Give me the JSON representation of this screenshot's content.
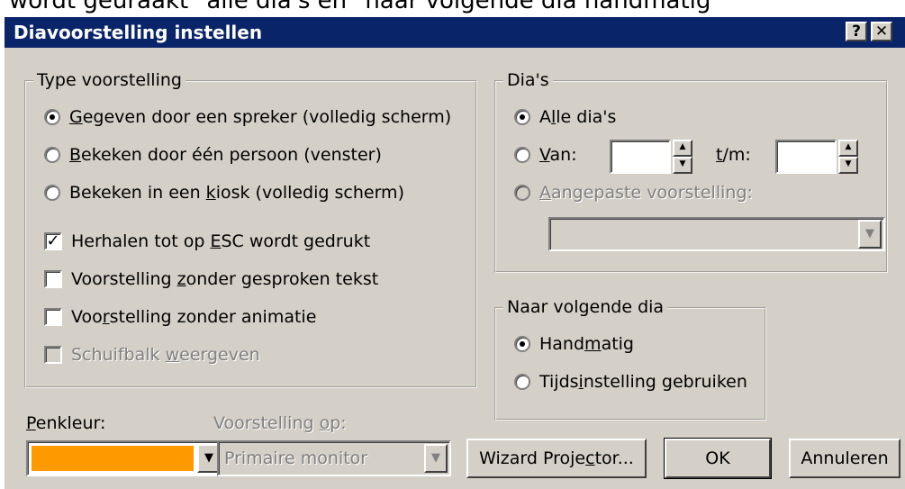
{
  "doc_text": "wordt geuraakt \"alle dia's en \"naar volgende dia handmatig",
  "dialog": {
    "title": "Diavoorstelling instellen",
    "help_label": "?",
    "close_label": "✕"
  },
  "type_group": {
    "legend": "Type voorstelling",
    "radios": [
      {
        "pre": "",
        "key": "G",
        "post": "egeven door een spreker (volledig scherm)",
        "checked": true
      },
      {
        "pre": "",
        "key": "B",
        "post": "ekeken door één persoon (venster)",
        "checked": false
      },
      {
        "pre": "Bekeken in een ",
        "key": "k",
        "post": "iosk (volledig scherm)",
        "checked": false
      }
    ],
    "checks": [
      {
        "pre": "Herhalen tot op ",
        "key": "E",
        "post": "SC wordt gedrukt",
        "checked": true,
        "disabled": false
      },
      {
        "pre": "Voorstelling ",
        "key": "z",
        "post": "onder gesproken tekst",
        "checked": false,
        "disabled": false
      },
      {
        "pre": "Voo",
        "key": "r",
        "post": "stelling zonder animatie",
        "checked": false,
        "disabled": false
      },
      {
        "pre": "Schuifbalk ",
        "key": "w",
        "post": "eergeven",
        "checked": false,
        "disabled": true
      }
    ],
    "check_mark": "✓"
  },
  "dias_group": {
    "legend": "Dia's",
    "all": {
      "pre": "A",
      "key": "l",
      "post": "le dia's",
      "checked": true
    },
    "van": {
      "pre": "",
      "key": "V",
      "post": "an:",
      "checked": false,
      "value": ""
    },
    "tm": {
      "pre": "",
      "key": "t",
      "post": "/m:",
      "value": ""
    },
    "custom": {
      "pre": "",
      "key": "A",
      "post": "angepaste voorstelling:",
      "checked": false,
      "disabled": true
    },
    "custom_value": "",
    "spin_up": "▲",
    "spin_down": "▼",
    "dd_arrow": "▼"
  },
  "next_group": {
    "legend": "Naar volgende dia",
    "manual": {
      "pre": "Hand",
      "key": "m",
      "post": "atig",
      "checked": true
    },
    "timed": {
      "pre": "Tijds",
      "key": "i",
      "post": "nstelling gebruiken",
      "checked": false
    }
  },
  "pen": {
    "label_key": "P",
    "label_post": "enkleur:",
    "color": "#ff9900",
    "dd_arrow": "▼"
  },
  "show_on": {
    "label_pre": "Voorstelling ",
    "label_key": "o",
    "label_post": "p:",
    "value": "Primaire monitor",
    "dd_arrow": "▼"
  },
  "buttons": {
    "wizard_pre": "Wizard Proje",
    "wizard_key": "c",
    "wizard_post": "tor...",
    "ok": "OK",
    "cancel": "Annuleren"
  }
}
